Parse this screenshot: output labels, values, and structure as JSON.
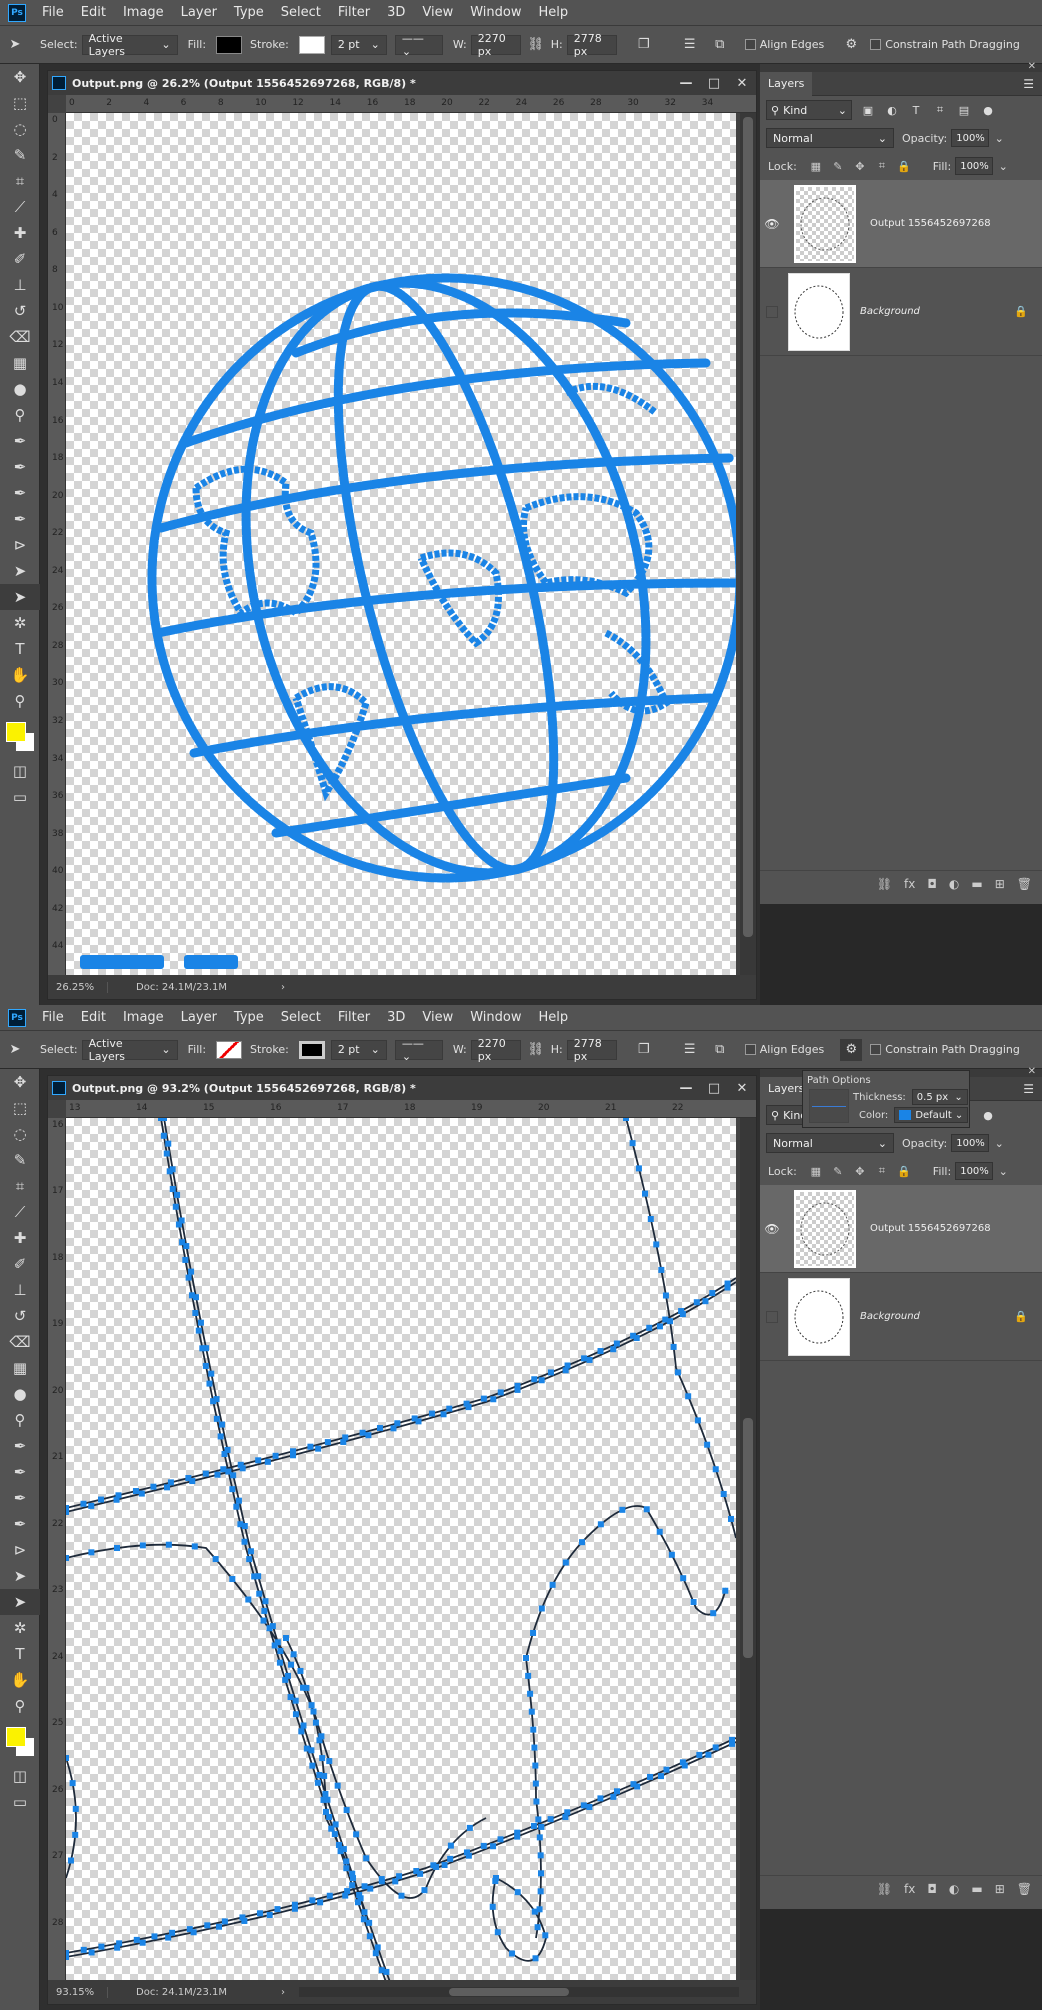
{
  "menu": [
    "File",
    "Edit",
    "Image",
    "Layer",
    "Type",
    "Select",
    "Filter",
    "3D",
    "View",
    "Window",
    "Help"
  ],
  "options": {
    "select_label": "Select:",
    "select_value": "Active Layers",
    "fill_label": "Fill:",
    "stroke_label": "Stroke:",
    "stroke_width": "2 pt",
    "w_label": "W:",
    "w_value": "2270 px",
    "h_label": "H:",
    "h_value": "2778 px",
    "align_edges": "Align Edges",
    "constrain": "Constrain Path Dragging"
  },
  "layers_panel": {
    "tab": "Layers",
    "filter_kind": "Kind",
    "blend_mode": "Normal",
    "opacity_label": "Opacity:",
    "opacity_value": "100%",
    "lock_label": "Lock:",
    "fill_label": "Fill:",
    "fill_value": "100%",
    "layers": [
      {
        "name": "Output 1556452697268"
      },
      {
        "name": "Background"
      }
    ]
  },
  "window1": {
    "title": "Output.png @ 26.2% (Output 1556452697268, RGB/8) *",
    "zoom": "26.25%",
    "doc": "Doc: 24.1M/23.1M",
    "hruler": [
      "0",
      "2",
      "4",
      "6",
      "8",
      "10",
      "12",
      "14",
      "16",
      "18",
      "20",
      "22",
      "24",
      "26",
      "28",
      "30",
      "32",
      "34"
    ],
    "vruler": [
      "0",
      "2",
      "4",
      "6",
      "8",
      "10",
      "12",
      "14",
      "16",
      "18",
      "20",
      "22",
      "24",
      "26",
      "28",
      "30",
      "32",
      "34",
      "36",
      "38",
      "40",
      "42",
      "44"
    ]
  },
  "window2": {
    "title": "Output.png @ 93.2% (Output 1556452697268, RGB/8) *",
    "zoom": "93.15%",
    "doc": "Doc: 24.1M/23.1M",
    "hruler": [
      "13",
      "14",
      "15",
      "16",
      "17",
      "18",
      "19",
      "20",
      "21",
      "22"
    ],
    "vruler": [
      "16",
      "17",
      "18",
      "19",
      "20",
      "21",
      "22",
      "23",
      "24",
      "25",
      "26",
      "27",
      "28"
    ]
  },
  "path_options": {
    "title": "Path Options",
    "thickness_label": "Thickness:",
    "thickness_value": "0.5 px",
    "color_label": "Color:",
    "color_value": "Default"
  },
  "colors": {
    "stroke_blue": "#1a84e6",
    "foreground": "#fbf200",
    "background": "#ffffff",
    "path_line": "#1e2a3a"
  }
}
